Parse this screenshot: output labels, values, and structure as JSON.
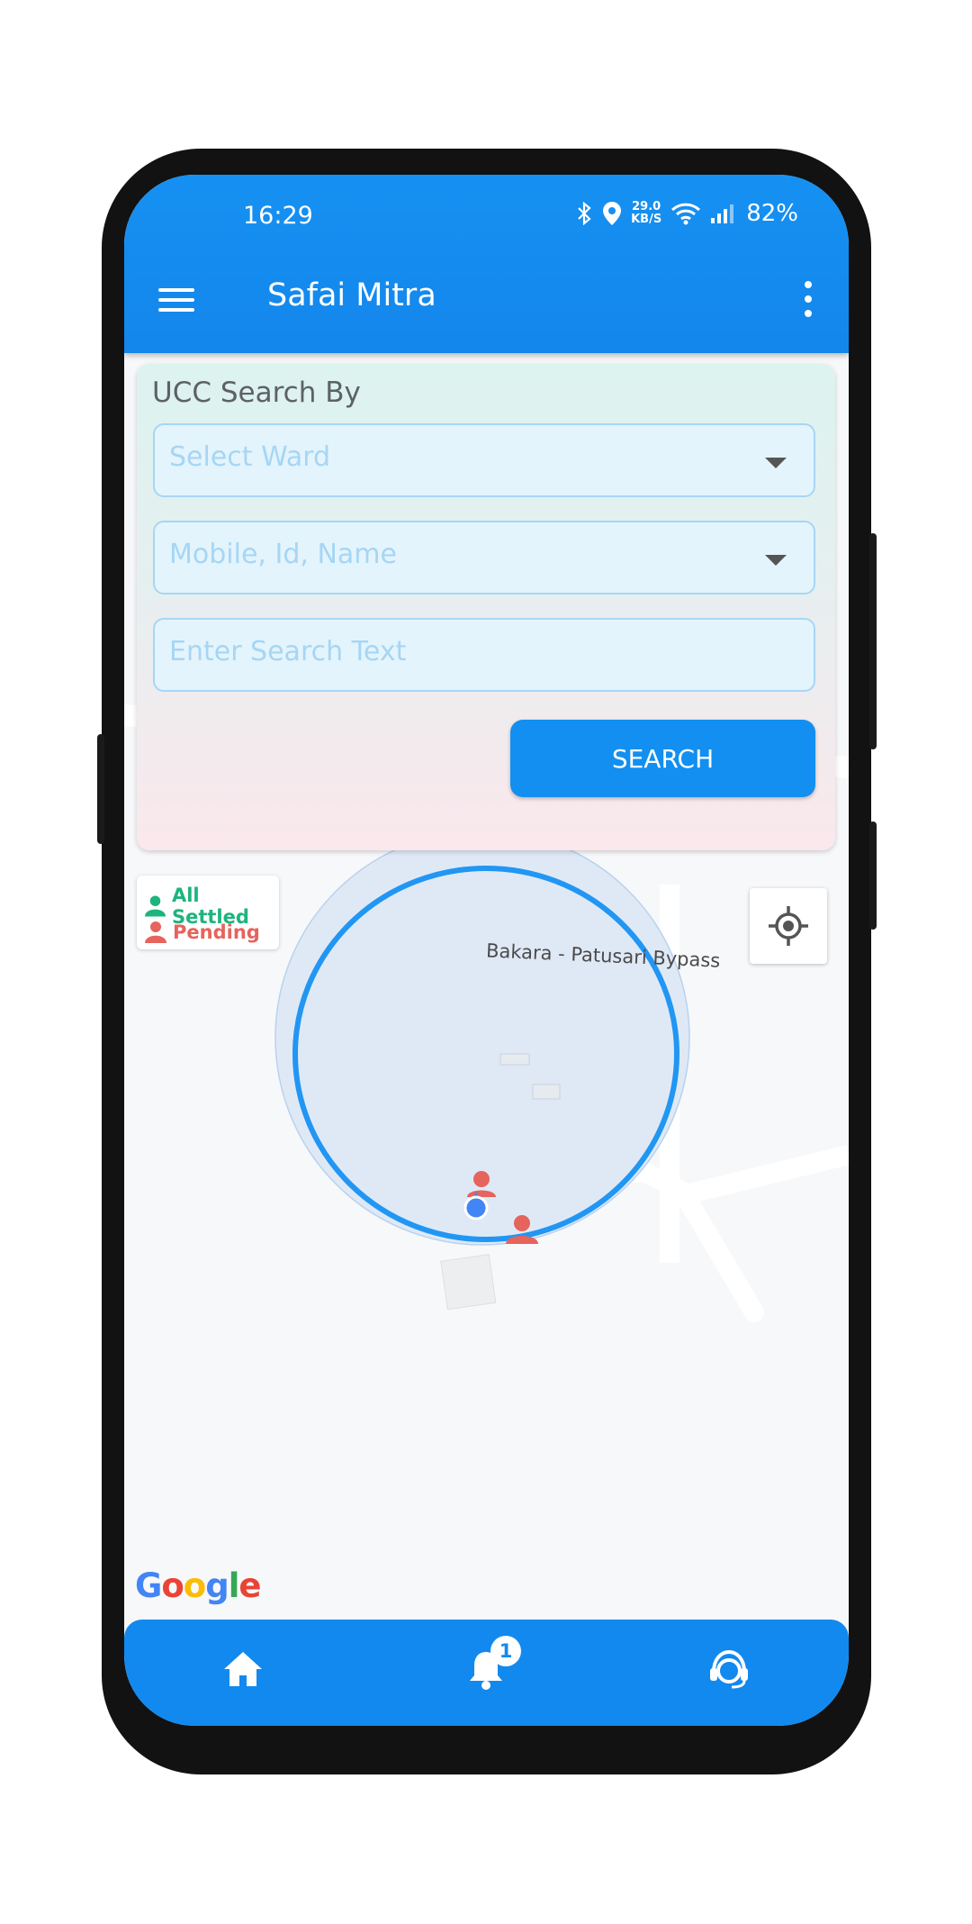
{
  "status_bar": {
    "time": "16:29",
    "speed_value": "29.0",
    "speed_unit": "KB/S",
    "battery": "82%",
    "icons": [
      "bluetooth-icon",
      "location-icon",
      "wifi-icon",
      "signal-icon"
    ]
  },
  "header": {
    "title": "Safai Mitra",
    "menu_icon": "hamburger-menu-icon",
    "more_icon": "more-vert-icon"
  },
  "search_card": {
    "title": "UCC Search By",
    "ward_placeholder": "Select Ward",
    "filter_placeholder": "Mobile, Id, Name",
    "text_placeholder": "Enter Search Text",
    "button_label": "SEARCH"
  },
  "legend": {
    "settled_label": "All Settled",
    "pending_label": "Pending",
    "settled_color": "#1db47d",
    "pending_color": "#e5645c"
  },
  "map": {
    "road_label": "Bakara - Patusari Bypass",
    "google_logo": "Google",
    "locate_icon": "my-location-icon"
  },
  "bottom_nav": {
    "items": [
      "home-icon",
      "notification-bell-icon",
      "support-agent-icon"
    ],
    "notification_count": "1"
  },
  "colors": {
    "primary": "#1591f2",
    "accent_circle": "#2196f3"
  }
}
